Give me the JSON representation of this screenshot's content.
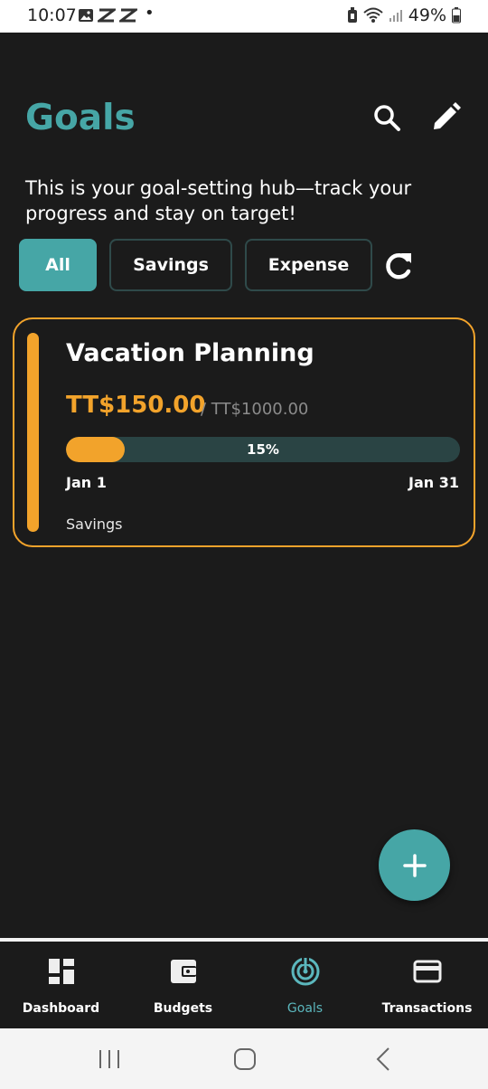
{
  "status_bar": {
    "time": "10:07",
    "battery": "49%"
  },
  "header": {
    "title": "Goals",
    "subtitle": "This is your goal-setting hub—track your progress and stay on target!"
  },
  "filters": {
    "chips": [
      {
        "label": "All",
        "active": true
      },
      {
        "label": "Savings",
        "active": false
      },
      {
        "label": "Expense",
        "active": false
      }
    ]
  },
  "goals": [
    {
      "name": "Vacation Planning",
      "current": "TT$150.00",
      "target": "/ TT$1000.00",
      "progress_percent": 15,
      "progress_label": "15%",
      "start_date": "Jan 1",
      "end_date": "Jan 31",
      "category": "Savings"
    }
  ],
  "bottom_nav": {
    "items": [
      {
        "label": "Dashboard",
        "icon": "dashboard-icon",
        "active": false
      },
      {
        "label": "Budgets",
        "icon": "wallet-icon",
        "active": false
      },
      {
        "label": "Goals",
        "icon": "target-icon",
        "active": true
      },
      {
        "label": "Transactions",
        "icon": "credit-card-icon",
        "active": false
      }
    ]
  },
  "colors": {
    "accent": "#46a6a6",
    "goal_accent": "#f2a32b",
    "background": "#1b1b1b"
  }
}
